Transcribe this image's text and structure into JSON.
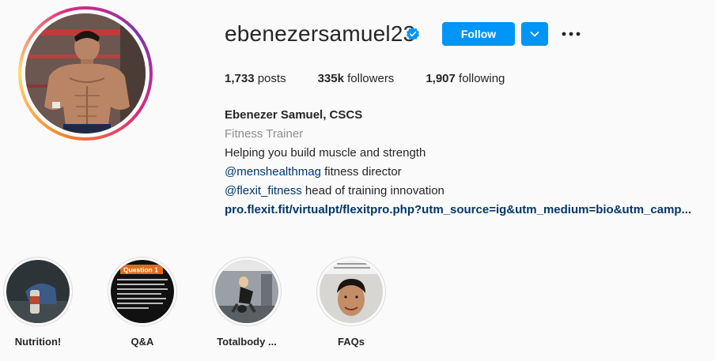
{
  "profile": {
    "username": "ebenezersamuel23",
    "verified_icon": "verified-badge-icon",
    "follow_label": "Follow",
    "dropdown_icon": "chevron-down-icon",
    "more_icon": "more-options-icon",
    "accent_color": "#0095f6"
  },
  "stats": {
    "posts_count": "1,733",
    "posts_label": "posts",
    "followers_count": "335k",
    "followers_label": "followers",
    "following_count": "1,907",
    "following_label": "following"
  },
  "bio": {
    "full_name": "Ebenezer Samuel, CSCS",
    "category": "Fitness Trainer",
    "line1": "Helping you build muscle and strength",
    "mention1": "@menshealthmag",
    "mention1_suffix": " fitness director",
    "mention2": "@flexit_fitness",
    "mention2_suffix": " head of training innovation",
    "link": "pro.flexit.fit/virtualpt/flexitpro.php?utm_source=ig&utm_medium=bio&utm_camp..."
  },
  "highlights": [
    {
      "label": "Nutrition!"
    },
    {
      "label": "Q&A",
      "card_title": "Question 1"
    },
    {
      "label": "Totalbody ..."
    },
    {
      "label": "FAQs"
    }
  ]
}
